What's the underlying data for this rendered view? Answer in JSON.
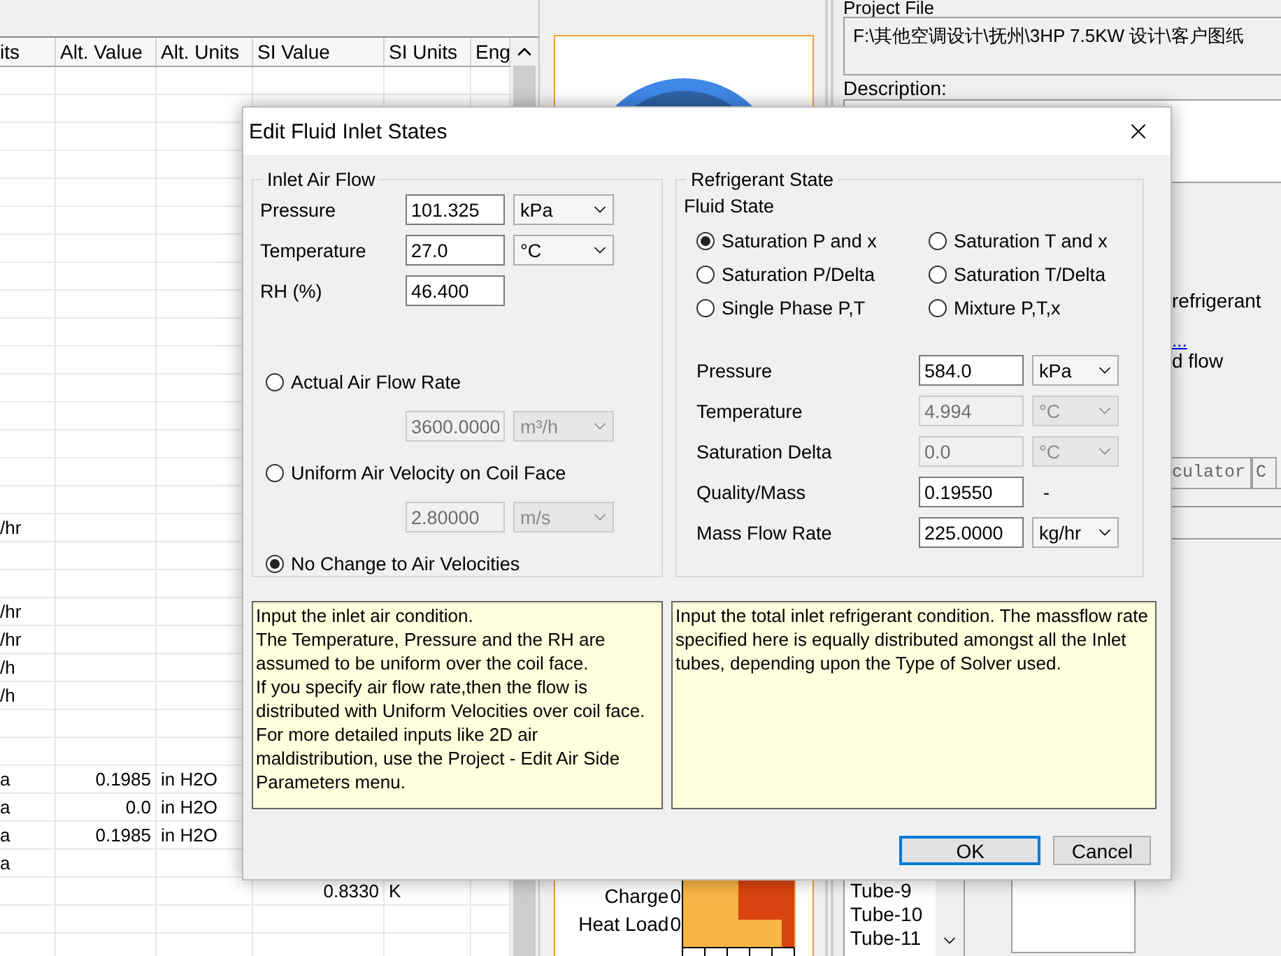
{
  "table": {
    "columns": [
      "its",
      "Alt. Value",
      "Alt. Units",
      "SI Value",
      "SI Units",
      "Eng"
    ],
    "rows": [
      {},
      {},
      {},
      {},
      {},
      {},
      {},
      {},
      {},
      {},
      {},
      {},
      {},
      {},
      {},
      {},
      {
        "units": "/hr"
      },
      {},
      {},
      {
        "units": "/hr"
      },
      {
        "units": "/hr"
      },
      {
        "units": "/h"
      },
      {
        "units": "/h"
      },
      {},
      {},
      {
        "units": "a",
        "alt_value": "0.1985",
        "alt_units": "in H2O"
      },
      {
        "units": "a",
        "alt_value": "0.0",
        "alt_units": "in H2O"
      },
      {
        "units": "a",
        "alt_value": "0.1985",
        "alt_units": "in H2O"
      },
      {
        "units": "a"
      },
      {
        "si_value": "0.8330",
        "si_units": "K"
      },
      {},
      {}
    ]
  },
  "chart_panel": {
    "bars": [
      {
        "label": "Charge",
        "value": "0"
      },
      {
        "label": "Heat Load",
        "value": "0"
      }
    ]
  },
  "project_panel": {
    "project_file_label": "Project File",
    "project_file": "F:\\其他空调设计\\抚州\\3HP 7.5KW 设计\\客户图纸",
    "description_label": "Description:",
    "notes": [
      {
        "kind": "text",
        "text": "refrigerant"
      },
      {
        "kind": "link",
        "text": "..."
      },
      {
        "kind": "text",
        "text": "d flow"
      }
    ],
    "tabs": [
      "culator",
      "C"
    ],
    "tube_list": [
      "Tube-9",
      "Tube-10",
      "Tube-11"
    ]
  },
  "dialog": {
    "title": "Edit Fluid Inlet States",
    "inlet_air": {
      "title": "Inlet Air Flow",
      "fields": [
        {
          "label": "Pressure",
          "value": "101.325",
          "unit": "kPa",
          "disabled": false
        },
        {
          "label": "Temperature",
          "value": "27.0",
          "unit": "°C",
          "disabled": false
        },
        {
          "label": "RH (%)",
          "value": "46.400",
          "disabled": false
        }
      ],
      "flow_options": [
        {
          "label": "Actual Air Flow Rate",
          "selected": false,
          "field": {
            "value": "3600.0000",
            "unit": "m³/h",
            "disabled": true
          }
        },
        {
          "label": "Uniform Air Velocity on Coil Face",
          "selected": false,
          "field": {
            "value": "2.80000",
            "unit": "m/s",
            "disabled": true
          }
        },
        {
          "label": "No Change to Air Velocities",
          "selected": true
        }
      ]
    },
    "refrigerant": {
      "title": "Refrigerant State",
      "fluid_state_label": "Fluid State",
      "states": [
        {
          "label": "Saturation P and x",
          "selected": true
        },
        {
          "label": "Saturation T and x",
          "selected": false
        },
        {
          "label": "Saturation P/Delta",
          "selected": false
        },
        {
          "label": "Saturation T/Delta",
          "selected": false
        },
        {
          "label": "Single Phase P,T",
          "selected": false
        },
        {
          "label": "Mixture P,T,x",
          "selected": false
        }
      ],
      "fields": [
        {
          "label": "Pressure",
          "value": "584.0",
          "unit": "kPa",
          "kind": "select",
          "disabled": false
        },
        {
          "label": "Temperature",
          "value": "4.994",
          "unit": "°C",
          "kind": "select",
          "disabled": true
        },
        {
          "label": "Saturation Delta",
          "value": "0.0",
          "unit": "°C",
          "kind": "select",
          "disabled": true
        },
        {
          "label": "Quality/Mass",
          "value": "0.19550",
          "unit": "-",
          "kind": "text",
          "disabled": false
        },
        {
          "label": "Mass Flow Rate",
          "value": "225.0000",
          "unit": "kg/hr",
          "kind": "select",
          "disabled": false
        }
      ]
    },
    "help": [
      "Input the inlet air condition.\nThe Temperature, Pressure and the RH are assumed to be uniform over the coil face.\nIf you specify air flow rate,then the flow is distributed with Uniform Velocities over coil face.\nFor more detailed inputs like 2D air maldistribution, use the Project - Edit Air Side Parameters menu.",
      "Input the total inlet refrigerant condition. The massflow rate specified here is equally distributed amongst all the Inlet tubes, depending upon the Type of Solver used."
    ],
    "buttons": [
      {
        "label": "OK",
        "default": true
      },
      {
        "label": "Cancel",
        "default": false
      }
    ]
  }
}
